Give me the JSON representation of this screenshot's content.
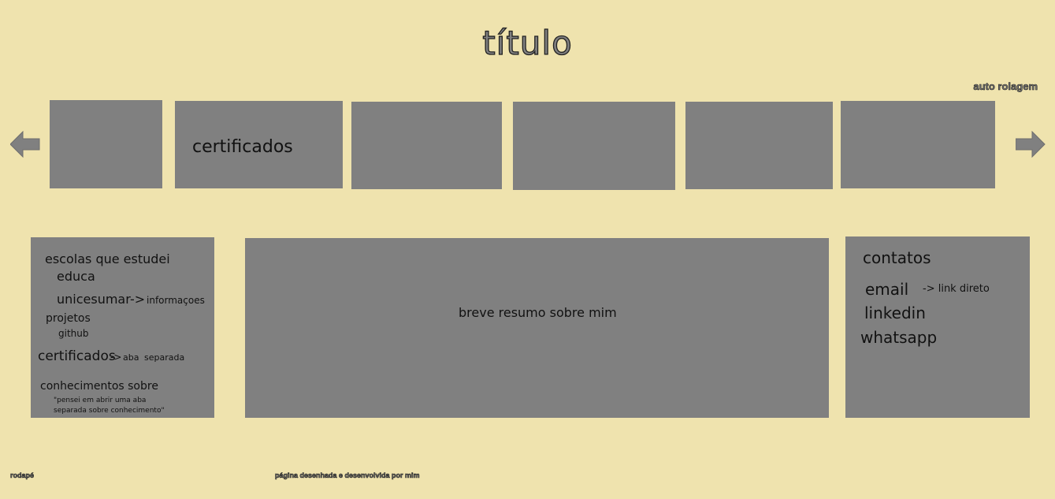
{
  "header": {
    "title": "título",
    "auto_scroll_label": "auto rolagem"
  },
  "carousel": {
    "left_arrow_icon": "arrow-left-icon",
    "right_arrow_icon": "arrow-right-icon",
    "cards": [
      "",
      "certificados",
      "",
      "",
      "",
      ""
    ]
  },
  "left_panel": {
    "schools_heading": "escolas que estudei",
    "school_1": "educa",
    "school_2": "unicesumar",
    "school_2_arrow": "->",
    "school_2_note": "informaçoes",
    "projects": "projetos",
    "github": "github",
    "certificates": "certificados",
    "certificates_arrow": "->",
    "certificates_note_1": "aba",
    "certificates_note_2": "separada",
    "knowledge": "conhecimentos sobre",
    "knowledge_note_1": "\"pensei em abrir uma aba",
    "knowledge_note_2": "separada sobre conhecimento\""
  },
  "center_panel": {
    "summary": "breve resumo sobre mim"
  },
  "right_panel": {
    "heading": "contatos",
    "email": "email",
    "email_note": "-> link direto",
    "linkedin": "linkedin",
    "whatsapp": "whatsapp"
  },
  "footer": {
    "left": "rodapé",
    "center": "página desenhada e desenvolvida por mim"
  },
  "colors": {
    "background": "#efe3ae",
    "box": "#808080"
  }
}
